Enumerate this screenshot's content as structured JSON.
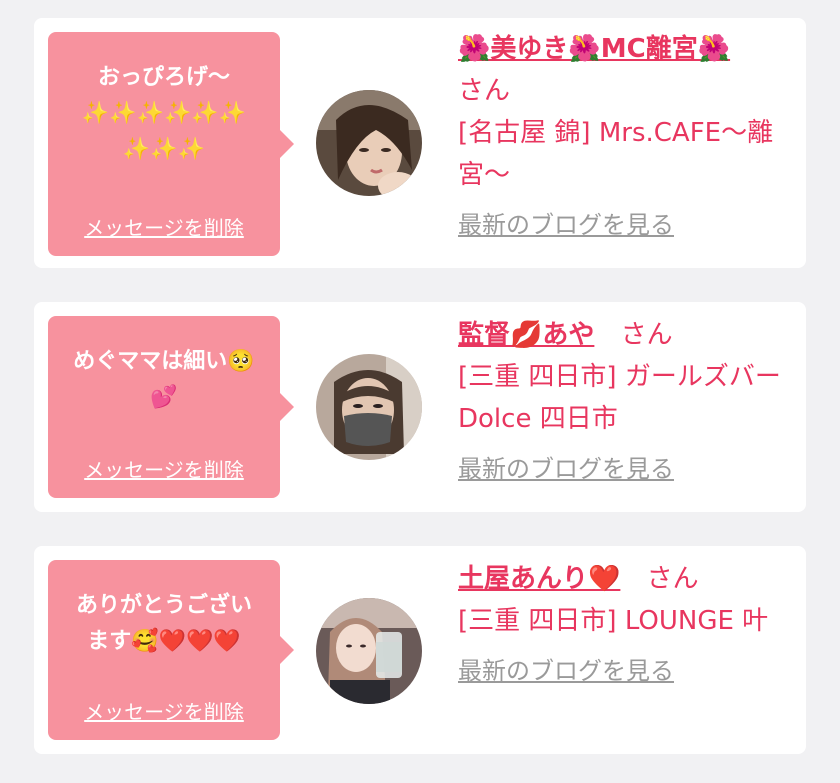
{
  "messages": [
    {
      "bubble_text": "おっぴろげ〜\n✨✨✨✨✨✨\n✨✨✨",
      "delete_label": "メッセージを削除",
      "name": "🌺美ゆき🌺MC離宮🌺",
      "honorific": "さん",
      "shop": "[名古屋 錦] Mrs.CAFE〜離宮〜",
      "blog_label": "最新のブログを見る"
    },
    {
      "bubble_text": "めぐママは細い🥺\n💕",
      "delete_label": "メッセージを削除",
      "name": "監督💋あや",
      "honorific": "さん",
      "shop": "[三重 四日市] ガールズバー Dolce 四日市",
      "blog_label": "最新のブログを見る"
    },
    {
      "bubble_text": "ありがとうござい\nます🥰❤️❤️❤️",
      "delete_label": "メッセージを削除",
      "name": "土屋あんり❤️",
      "honorific": "さん",
      "shop": "[三重 四日市] LOUNGE 叶",
      "blog_label": "最新のブログを見る"
    }
  ],
  "colors": {
    "background": "#f1f1f3",
    "bubble": "#f7929e",
    "accent": "#e8365f",
    "muted": "#9a9a9a"
  }
}
